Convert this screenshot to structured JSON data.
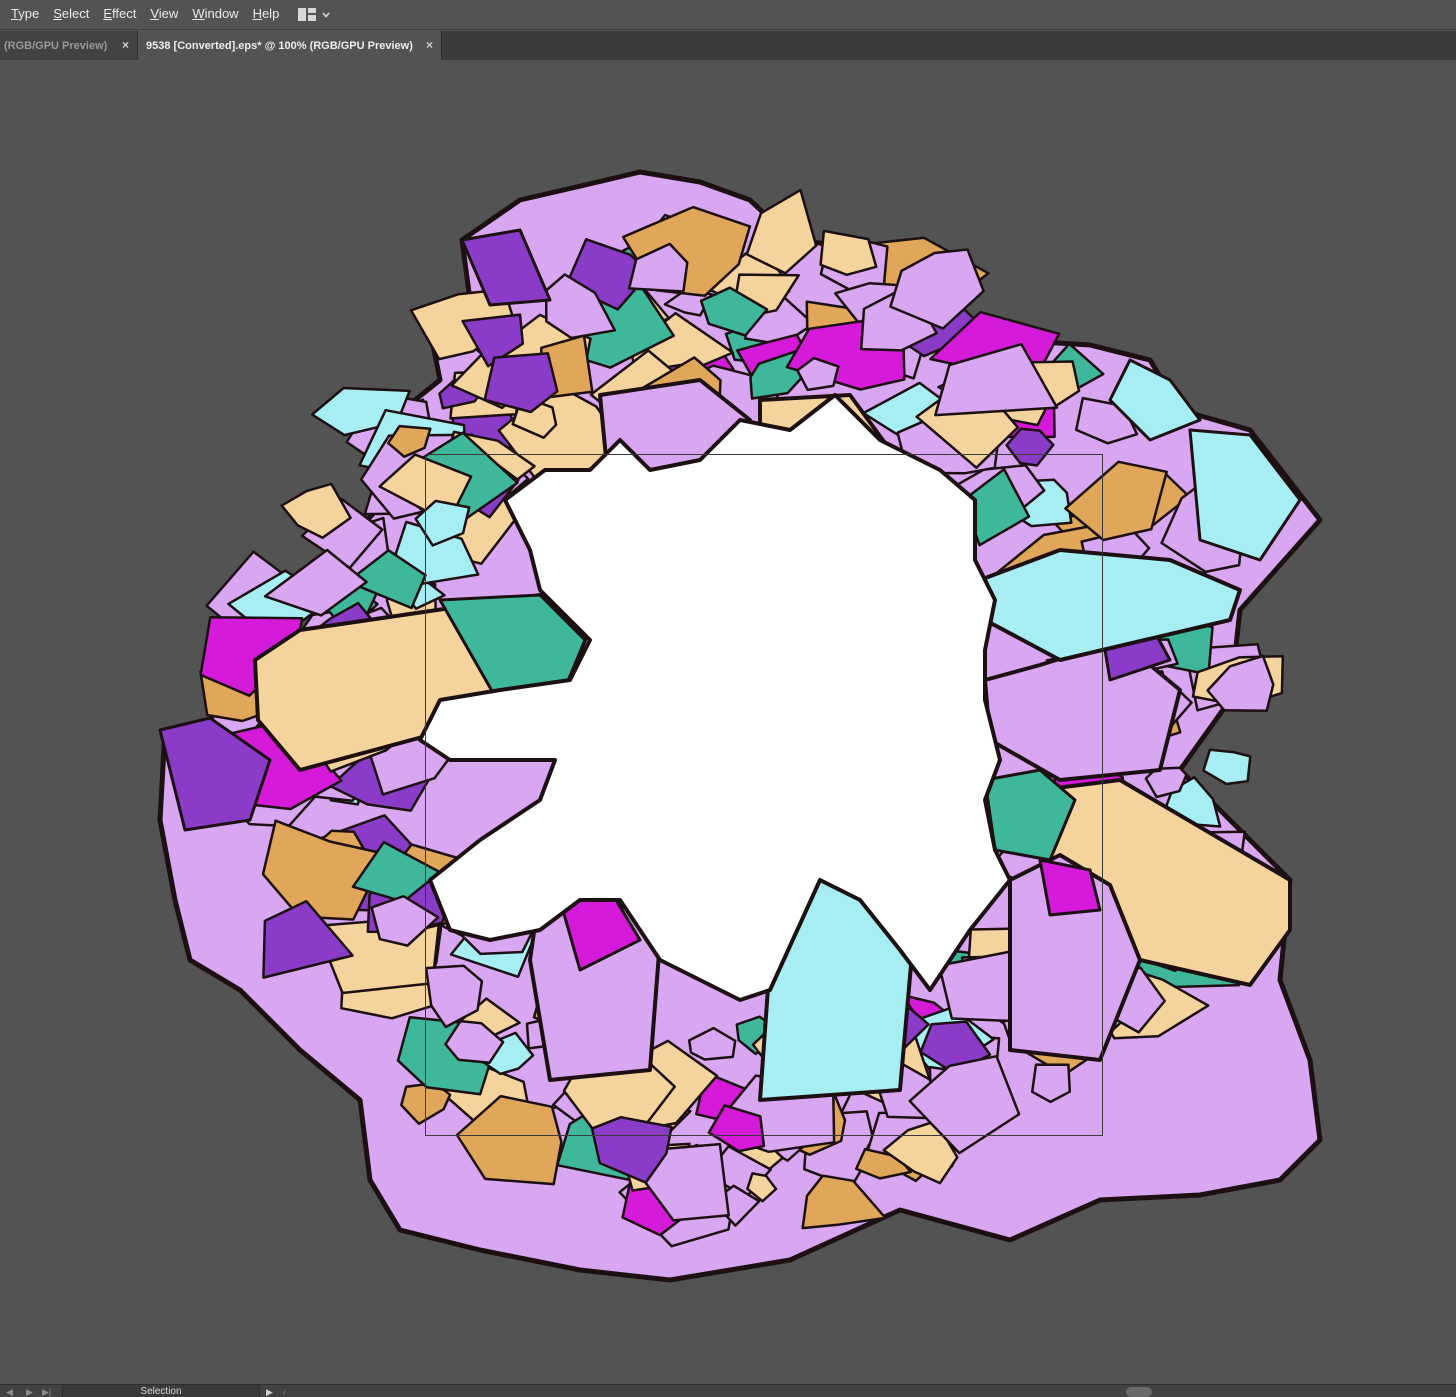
{
  "menu": {
    "items": [
      "Type",
      "Select",
      "Effect",
      "View",
      "Window",
      "Help"
    ]
  },
  "workspace_switcher": {
    "icon": "grid-layout-icon",
    "chevron": "chevron-down-icon"
  },
  "tabs": [
    {
      "label": "(RGB/GPU Preview)",
      "active": false,
      "close": "×"
    },
    {
      "label": "9538 [Converted].eps* @ 100% (RGB/GPU Preview)",
      "active": true,
      "close": "×"
    }
  ],
  "status": {
    "tool": "Selection",
    "nav_icons": [
      "chevron-left-icon",
      "play-icon",
      "skip-end-icon",
      "play-icon",
      "chevron-left-icon"
    ]
  },
  "artwork": {
    "description_icon": "crystal-wreath-artwork",
    "colors": {
      "purple": "#d9a6f2",
      "deep_purple": "#8a3cc9",
      "magenta": "#d51ad9",
      "tan": "#f4d39c",
      "orange": "#e0a65a",
      "aqua": "#a6eef2",
      "teal": "#3fb79a",
      "outline": "#1d1012",
      "artboard": "#ffffff"
    }
  }
}
